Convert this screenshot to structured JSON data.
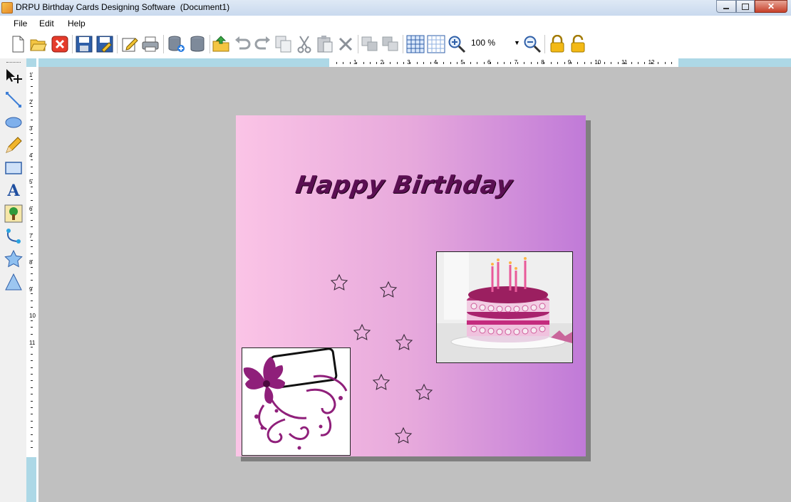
{
  "window": {
    "title": "DRPU Birthday Cards Designing Software  (Document1)"
  },
  "menu": {
    "items": [
      "File",
      "Edit",
      "Help"
    ]
  },
  "toolbar": {
    "zoom_value": "100 %"
  },
  "ruler": {
    "top_numbers": [
      "1",
      "2",
      "3",
      "4",
      "5",
      "6",
      "7",
      "8",
      "9",
      "10",
      "11",
      "12"
    ],
    "left_numbers": [
      "1",
      "2",
      "3",
      "4",
      "5",
      "6",
      "7",
      "8",
      "9",
      "10",
      "11"
    ]
  },
  "card": {
    "title": "Happy Birthday",
    "background_colors": [
      "#fbc4e6",
      "#c07ad8"
    ],
    "title_color": "#5a0f52"
  },
  "icons": {
    "toolbar": [
      "new-document-icon",
      "open-folder-icon",
      "close-document-icon",
      "save-icon",
      "save-as-icon",
      "edit-icon",
      "print-icon",
      "export-database-icon",
      "database-icon",
      "open-image-icon",
      "undo-icon",
      "redo-icon",
      "copy-icon",
      "cut-icon",
      "paste-icon",
      "delete-icon",
      "group-icon",
      "ungroup-icon",
      "show-grid-icon",
      "snap-grid-icon",
      "zoom-in-icon",
      "zoom-out-icon",
      "lock-icon",
      "unlock-icon"
    ],
    "tools": [
      "select-icon",
      "line-icon",
      "ellipse-icon",
      "pencil-icon",
      "rectangle-icon",
      "text-icon",
      "picture-icon",
      "curve-icon",
      "star-icon",
      "triangle-icon"
    ]
  }
}
